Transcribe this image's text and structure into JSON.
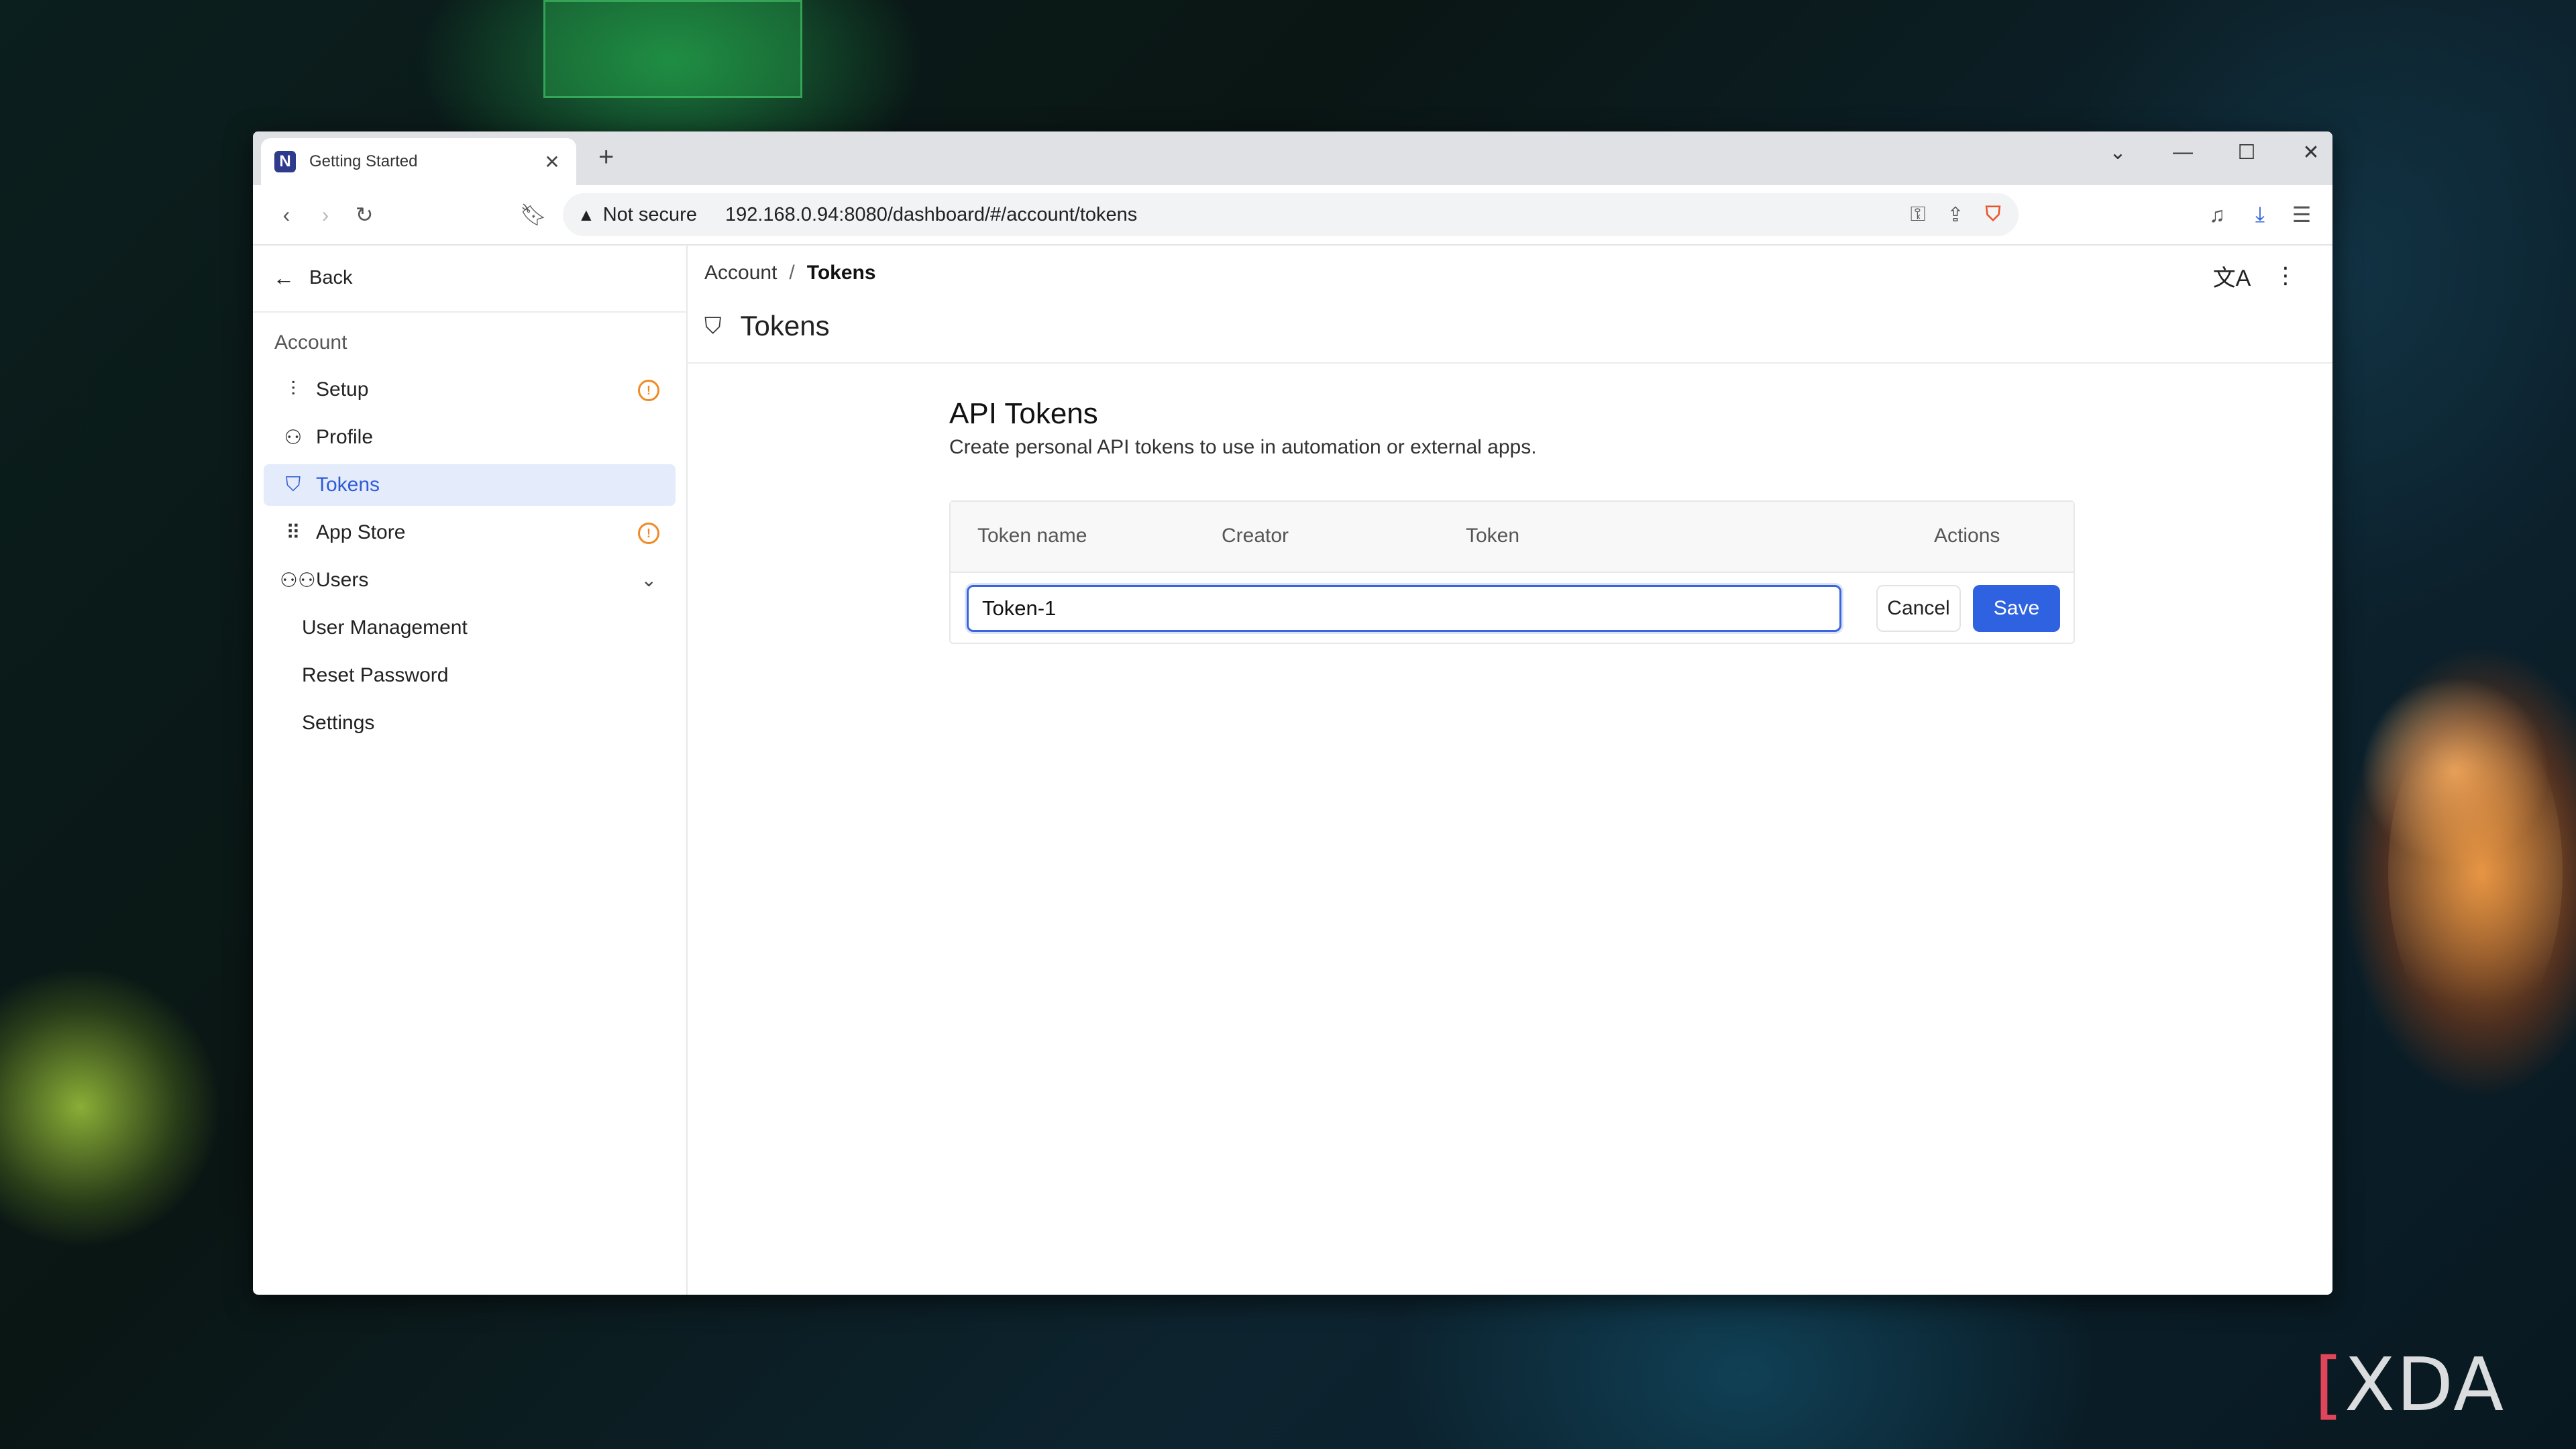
{
  "browser": {
    "tab_title": "Getting Started",
    "tab_favicon_letter": "N",
    "new_tab_glyph": "+",
    "close_glyph": "✕",
    "security_label": "Not secure",
    "url": "192.168.0.94:8080/dashboard/#/account/tokens",
    "colors": {
      "tabbar_bg": "#dfe1e5",
      "brave_accent": "#e8542c"
    }
  },
  "sidebar": {
    "back_label": "Back",
    "section_label": "Account",
    "items": [
      {
        "label": "Setup",
        "icon": "sliders-icon",
        "badge": "!"
      },
      {
        "label": "Profile",
        "icon": "user-icon"
      },
      {
        "label": "Tokens",
        "icon": "shield-icon",
        "active": true
      },
      {
        "label": "App Store",
        "icon": "grid-icon",
        "badge": "!"
      },
      {
        "label": "Users",
        "icon": "users-icon",
        "expanded": true
      }
    ],
    "sub_items": [
      "User Management",
      "Reset Password",
      "Settings"
    ]
  },
  "main": {
    "breadcrumb": {
      "parent": "Account",
      "separator": "/",
      "current": "Tokens"
    },
    "page_title": "Tokens",
    "section_title": "API Tokens",
    "section_description": "Create personal API tokens to use in automation or external apps.",
    "table": {
      "columns": [
        "Token name",
        "Creator",
        "Token",
        "Actions"
      ],
      "new_token_value": "Token-1",
      "cancel_label": "Cancel",
      "save_label": "Save"
    },
    "colors": {
      "accent": "#2f62e0",
      "active_bg": "#e4ebfb",
      "warning": "#f08a24"
    }
  },
  "watermark": {
    "bracket": "[",
    "text": "XDA"
  }
}
